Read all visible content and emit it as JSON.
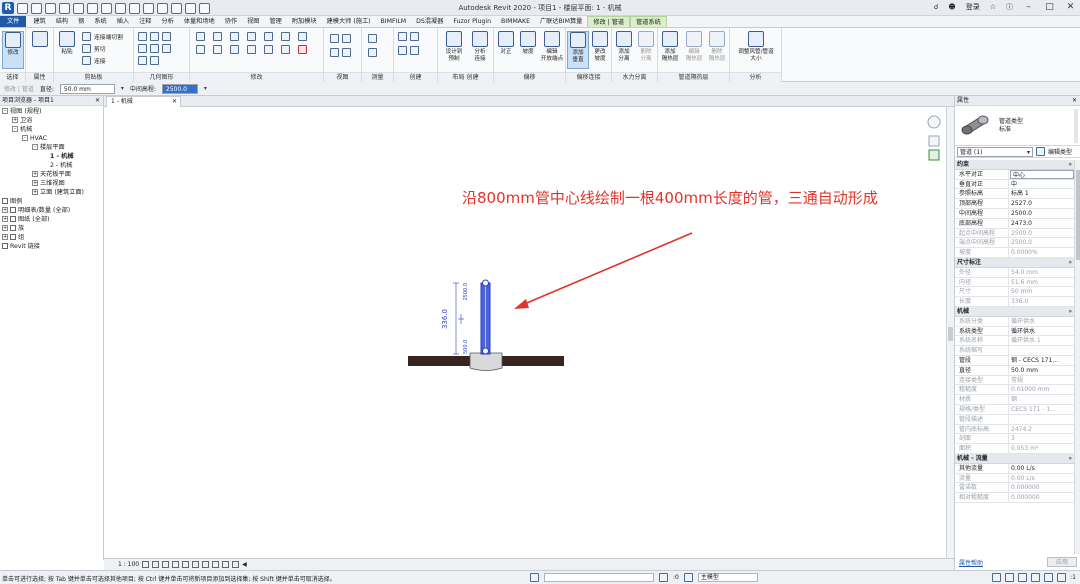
{
  "app": {
    "title": "Autodesk Revit 2020 - 项目1 - 楼层平面: 1 - 机械",
    "logo": "R",
    "user_label": "登录",
    "search_icon": "binoculars-icon"
  },
  "tabs": [
    {
      "label": "文件",
      "type": "file"
    },
    {
      "label": "建筑"
    },
    {
      "label": "结构"
    },
    {
      "label": "钢"
    },
    {
      "label": "系统"
    },
    {
      "label": "插入"
    },
    {
      "label": "注释"
    },
    {
      "label": "分析"
    },
    {
      "label": "体量和场地"
    },
    {
      "label": "协作"
    },
    {
      "label": "视图"
    },
    {
      "label": "管理"
    },
    {
      "label": "附加模块"
    },
    {
      "label": "建模大师 (施工)"
    },
    {
      "label": "BIMFILM"
    },
    {
      "label": "DS混凝器"
    },
    {
      "label": "Fuzor Plugin"
    },
    {
      "label": "BIMMAKE"
    },
    {
      "label": "广联达BIM算量"
    },
    {
      "label": "修改 | 管道",
      "type": "ctx"
    },
    {
      "label": "管道系统",
      "type": "ctx"
    }
  ],
  "ribbon": {
    "panels": {
      "select": "选择",
      "properties": "属性",
      "clipboard": "剪贴板",
      "geometry": "几何图形",
      "modify": "修改",
      "view": "视图",
      "measure": "测量",
      "create": "创建",
      "layout": "布局",
      "offset": "偏移",
      "edit": "编辑",
      "offset_connect": "偏移连接",
      "hydraulic": "水力分离",
      "insulation": "管道隔热层",
      "analysis": "分析"
    },
    "buttons": {
      "modify": "修改",
      "paste": "粘贴",
      "cut_join": "连接端切割",
      "cut": "剪切",
      "join": "连接",
      "design_system": "设计到",
      "preset": "预制",
      "analysis_connect": "分析",
      "connect": "连接",
      "justify": "对正",
      "slope": "坡度",
      "edit_open_end": "编辑",
      "open_end": "开放端点",
      "add_perp": "添加",
      "perp": "垂直",
      "change_slope": "更改",
      "slope2": "坡度",
      "add_sep": "添加",
      "sep": "分离",
      "del_sep": "删除",
      "sep2": "分离",
      "add_ins": "添加",
      "ins": "隔热层",
      "edit_ins": "编辑",
      "ins2": "隔热层",
      "del_ins": "删除",
      "ins3": "隔热层",
      "resize": "调整风管/管道",
      "size": "大小"
    }
  },
  "options_bar": {
    "context": "修改 | 管道",
    "diameter_label": "直径:",
    "diameter_value": "50.0 mm",
    "offset_label": "中间高程:",
    "offset_value": "2500.0 mm"
  },
  "project_browser": {
    "title": "项目浏览器 - 项目1",
    "items": [
      {
        "label": "视图 (规程)",
        "level": 0,
        "exp": "-"
      },
      {
        "label": "卫浴",
        "level": 1,
        "exp": "+"
      },
      {
        "label": "机械",
        "level": 1,
        "exp": "-"
      },
      {
        "label": "HVAC",
        "level": 2,
        "exp": "-"
      },
      {
        "label": "楼层平面",
        "level": 3,
        "exp": "-"
      },
      {
        "label": "1 - 机械",
        "level": 4,
        "exp": "",
        "bold": true
      },
      {
        "label": "2 - 机械",
        "level": 4,
        "exp": ""
      },
      {
        "label": "天花板平面",
        "level": 3,
        "exp": "+"
      },
      {
        "label": "三维视图",
        "level": 3,
        "exp": "+"
      },
      {
        "label": "立面 (建筑立面)",
        "level": 3,
        "exp": "+"
      },
      {
        "label": "图例",
        "level": 0,
        "exp": "",
        "icon": true
      },
      {
        "label": "明细表/数量 (全部)",
        "level": 0,
        "exp": "+",
        "icon": true
      },
      {
        "label": "图纸 (全部)",
        "level": 0,
        "exp": "+",
        "icon": true
      },
      {
        "label": "族",
        "level": 0,
        "exp": "+",
        "icon": true
      },
      {
        "label": "组",
        "level": 0,
        "exp": "+",
        "icon": true
      },
      {
        "label": "Revit 链接",
        "level": 0,
        "exp": "",
        "icon": true
      }
    ]
  },
  "view": {
    "tab_label": "1 - 机械",
    "annotation": "沿800mm管中心线绘制一根400mm长度的管，三通自动形成",
    "dim_length": "336.0",
    "dim_top": "2500.0",
    "dim_bottom": "500.0",
    "annotation_color": "#e0342a",
    "pipe_color": "#2b3fbf",
    "main_pipe_color": "#3a2420",
    "scale": "1 : 100"
  },
  "properties": {
    "title": "属性",
    "type_family": "管道类型",
    "type_name": "标准",
    "instance_selector": "管道 (1)",
    "edit_type": "编辑类型",
    "sections": [
      {
        "name": "约束",
        "rows": [
          {
            "k": "水平对正",
            "v": "中心",
            "box": true
          },
          {
            "k": "垂直对正",
            "v": "中"
          },
          {
            "k": "参照标高",
            "v": "标高 1"
          },
          {
            "k": "顶部高程",
            "v": "2527.0"
          },
          {
            "k": "中间高程",
            "v": "2500.0"
          },
          {
            "k": "底部高程",
            "v": "2473.0"
          },
          {
            "k": "起点中间高程",
            "v": "2500.0",
            "dim": true
          },
          {
            "k": "端点中间高程",
            "v": "2500.0",
            "dim": true
          },
          {
            "k": "坡度",
            "v": "0.0000%",
            "dim": true
          }
        ]
      },
      {
        "name": "尺寸标注",
        "rows": [
          {
            "k": "外径",
            "v": "54.0 mm",
            "dim": true
          },
          {
            "k": "内径",
            "v": "51.6 mm",
            "dim": true
          },
          {
            "k": "尺寸",
            "v": "50 mm",
            "dim": true
          },
          {
            "k": "长度",
            "v": "336.0",
            "dim": true
          }
        ]
      },
      {
        "name": "机械",
        "rows": [
          {
            "k": "系统分类",
            "v": "循环供水",
            "dim": true
          },
          {
            "k": "系统类型",
            "v": "循环供水"
          },
          {
            "k": "系统名称",
            "v": "循环供水 1",
            "dim": true
          },
          {
            "k": "系统缩写",
            "v": "",
            "dim": true
          },
          {
            "k": "管段",
            "v": "钢 - CECS 171..."
          },
          {
            "k": "直径",
            "v": "50.0 mm"
          },
          {
            "k": "连接类型",
            "v": "常规",
            "dim": true
          },
          {
            "k": "粗糙度",
            "v": "0.01000 mm",
            "dim": true
          },
          {
            "k": "材质",
            "v": "钢",
            "dim": true
          },
          {
            "k": "规格/类型",
            "v": "CECS 171 - 1...",
            "dim": true
          },
          {
            "k": "管段描述",
            "v": "",
            "dim": true
          },
          {
            "k": "管内底标高",
            "v": "2474.2",
            "dim": true
          },
          {
            "k": "剖面",
            "v": "3",
            "dim": true
          },
          {
            "k": "面积",
            "v": "0.053 m²",
            "dim": true
          }
        ]
      },
      {
        "name": "机械 - 流量",
        "rows": [
          {
            "k": "其他流量",
            "v": "0.00 L/s"
          },
          {
            "k": "流量",
            "v": "0.00 L/s",
            "dim": true
          },
          {
            "k": "雷诺数",
            "v": "0.000000",
            "dim": true
          },
          {
            "k": "相对粗糙度",
            "v": "0.000000",
            "dim": true
          }
        ]
      }
    ],
    "help_link": "属性帮助",
    "apply": "应用"
  },
  "status": {
    "message": "单击可进行选择; 按 Tab 键并单击可选择其他项目; 按 Ctrl 键并单击可将新项目添加到选择集; 按 Shift 键并单击可取消选择。",
    "zero": ":0",
    "model": "主模型",
    "filter": ":1"
  }
}
